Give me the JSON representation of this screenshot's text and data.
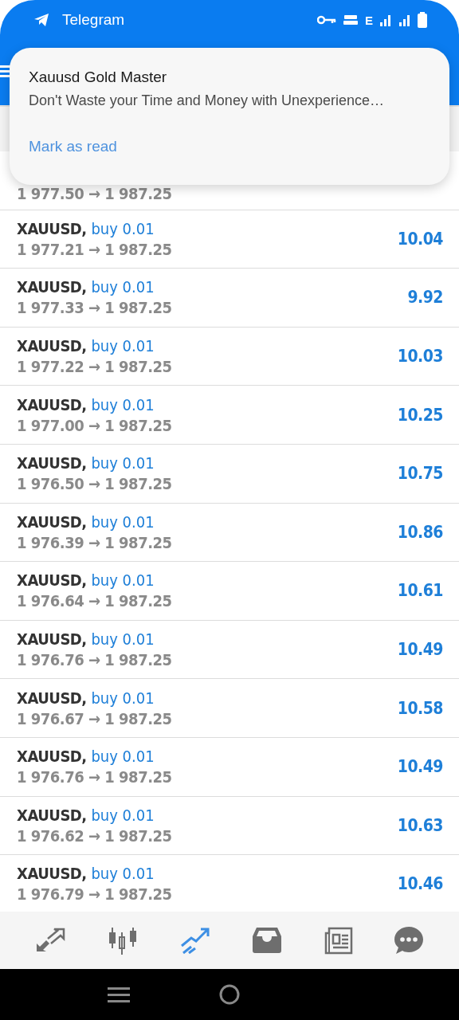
{
  "status_bar": {
    "app": "Telegram",
    "network": "E"
  },
  "notification": {
    "title": "Xauusd Gold Master",
    "message": "Don't Waste your Time and Money with Unexperience…",
    "action": "Mark as read"
  },
  "partial_row": {
    "prices": "1 977.50 → 1 987.25"
  },
  "trades": [
    {
      "symbol": "XAUUSD,",
      "side": "buy 0.01",
      "prices": "1 977.21 → 1 987.25",
      "profit": "10.04"
    },
    {
      "symbol": "XAUUSD,",
      "side": "buy 0.01",
      "prices": "1 977.33 → 1 987.25",
      "profit": "9.92"
    },
    {
      "symbol": "XAUUSD,",
      "side": "buy 0.01",
      "prices": "1 977.22 → 1 987.25",
      "profit": "10.03"
    },
    {
      "symbol": "XAUUSD,",
      "side": "buy 0.01",
      "prices": "1 977.00 → 1 987.25",
      "profit": "10.25"
    },
    {
      "symbol": "XAUUSD,",
      "side": "buy 0.01",
      "prices": "1 976.50 → 1 987.25",
      "profit": "10.75"
    },
    {
      "symbol": "XAUUSD,",
      "side": "buy 0.01",
      "prices": "1 976.39 → 1 987.25",
      "profit": "10.86"
    },
    {
      "symbol": "XAUUSD,",
      "side": "buy 0.01",
      "prices": "1 976.64 → 1 987.25",
      "profit": "10.61"
    },
    {
      "symbol": "XAUUSD,",
      "side": "buy 0.01",
      "prices": "1 976.76 → 1 987.25",
      "profit": "10.49"
    },
    {
      "symbol": "XAUUSD,",
      "side": "buy 0.01",
      "prices": "1 976.67 → 1 987.25",
      "profit": "10.58"
    },
    {
      "symbol": "XAUUSD,",
      "side": "buy 0.01",
      "prices": "1 976.76 → 1 987.25",
      "profit": "10.49"
    },
    {
      "symbol": "XAUUSD,",
      "side": "buy 0.01",
      "prices": "1 976.62 → 1 987.25",
      "profit": "10.63"
    },
    {
      "symbol": "XAUUSD,",
      "side": "buy 0.01",
      "prices": "1 976.79 → 1 987.25",
      "profit": "10.46"
    }
  ],
  "bottom_nav": [
    {
      "kind": "quotes",
      "selected": false
    },
    {
      "kind": "chart",
      "selected": false
    },
    {
      "kind": "trade",
      "selected": true
    },
    {
      "kind": "history",
      "selected": false
    },
    {
      "kind": "news",
      "selected": false
    },
    {
      "kind": "chat",
      "selected": false
    }
  ]
}
